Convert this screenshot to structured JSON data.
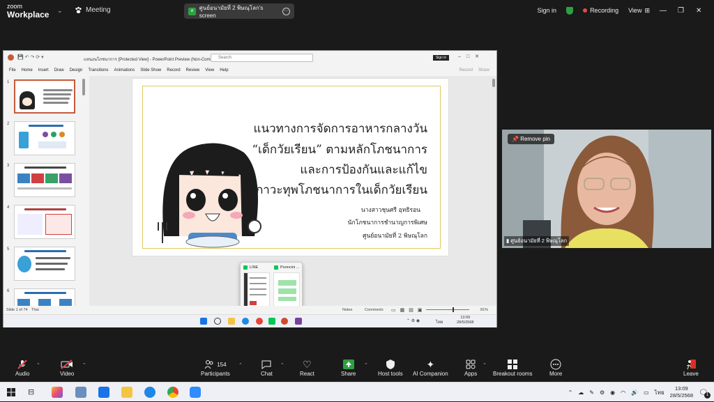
{
  "zoom": {
    "logo_top": "zoom",
    "logo_bottom": "Workplace",
    "meeting_label": "Meeting",
    "share_label": "ศูนย์อนามัยที่ 2 พิษณุโลก's screen",
    "signin": "Sign in",
    "recording": "Recording",
    "view": "View"
  },
  "ppt": {
    "doc_title": "แหนงนโภชนาการ [Protected View] - PowerPoint Preview (Non-Commercial...",
    "search_placeholder": "Search",
    "signin": "Sign in",
    "menu": [
      "File",
      "Home",
      "Insert",
      "Draw",
      "Design",
      "Transitions",
      "Animations",
      "Slide Show",
      "Record",
      "Review",
      "View",
      "Help"
    ],
    "record_btn": "Record",
    "share_btn": "Share",
    "slide_numbers": [
      "1",
      "2",
      "3",
      "4",
      "5",
      "6"
    ],
    "slide": {
      "title_lines": [
        "แนวทางการจัดการอาหารกลางวัน",
        "“เด็กวัยเรียน” ตามหลักโภชนาการ",
        "และการป้องกันและแก้ไข",
        "ภาวะทุพโภชนาการในเด็กวัยเรียน"
      ],
      "presenter": "นางสาวชุนศรี อุทธิรอน",
      "position": "นักโภชนาการชำนาญการพิเศษ",
      "org": "ศูนย์อนามัยที่ 2 พิษณุโลก"
    },
    "status": {
      "slide_count": "Slide 1 of 74",
      "lang": "Thai",
      "notes": "Notes",
      "comments": "Comments",
      "zoom": "81%"
    },
    "popup": {
      "app1": "LINE",
      "app2": "Pooncini ..."
    },
    "taskbar_lang": "ไทย",
    "taskbar_time": "13:09",
    "taskbar_date": "28/5/2568"
  },
  "video": {
    "remove_pin": "Remove pin",
    "name": "ศูนย์อนามัยที่ 2 พิษณุโลก"
  },
  "toolbar": {
    "audio": "Audio",
    "video": "Video",
    "participants": "Participants",
    "participants_count": "154",
    "chat": "Chat",
    "react": "React",
    "share": "Share",
    "host_tools": "Host tools",
    "ai_companion": "AI Companion",
    "apps": "Apps",
    "breakout": "Breakout rooms",
    "more": "More",
    "leave": "Leave"
  },
  "windows": {
    "lang": "ไทย",
    "time": "13:09",
    "date": "28/5/2568",
    "notif_count": "1"
  },
  "colors": {
    "zoom_bg": "#1a1a1a",
    "recording_red": "#e5484d",
    "share_green": "#2ea043",
    "leave_red": "#d93025",
    "ppt_accent": "#c55a3a"
  }
}
